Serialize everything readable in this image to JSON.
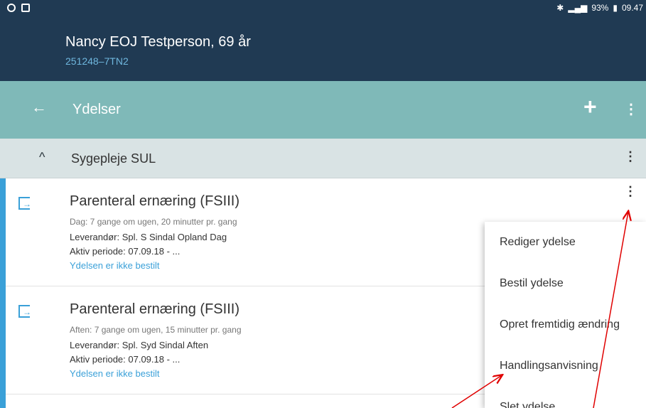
{
  "status_bar": {
    "left_icons": [
      "eye-icon",
      "camera-icon"
    ],
    "right_icons": [
      "bluetooth-icon",
      "signal-icon",
      "battery-icon"
    ],
    "battery": "93%",
    "time": "09.47"
  },
  "patient": {
    "name": "Nancy EOJ Testperson, 69 år",
    "id": "251248–7TN2"
  },
  "toolbar": {
    "title": "Ydelser",
    "back_glyph": "←",
    "add_glyph": "+",
    "more_glyph": "⋮"
  },
  "section": {
    "title": "Sygepleje SUL",
    "chevron_glyph": "^",
    "more_glyph": "⋮"
  },
  "items": [
    {
      "title": "Parenteral ernæring (FSIII)",
      "subtitle": "Dag: 7 gange om ugen, 20 minutter pr. gang",
      "provider": "Leverandør:  Spl. S Sindal Opland Dag",
      "period": "Aktiv periode:  07.09.18  -  ...",
      "status": "Ydelsen er ikke bestilt",
      "more_glyph": "⋮"
    },
    {
      "title": "Parenteral ernæring (FSIII)",
      "subtitle": "Aften: 7 gange om ugen, 15 minutter pr. gang",
      "provider": "Leverandør:  Spl. Syd Sindal Aften",
      "period": "Aktiv periode:  07.09.18  -  ...",
      "status": "Ydelsen er ikke bestilt"
    }
  ],
  "context_menu": {
    "items": [
      "Rediger ydelse",
      "Bestil ydelse",
      "Opret fremtidig ændring",
      "Handlingsanvisning",
      "Slet ydelse"
    ]
  },
  "colors": {
    "header_dark": "#203a53",
    "toolbar_teal": "#7fb9b8",
    "section_gray": "#d9e3e4",
    "accent_blue": "#3aa0d8",
    "annotation_red": "#e00000"
  }
}
